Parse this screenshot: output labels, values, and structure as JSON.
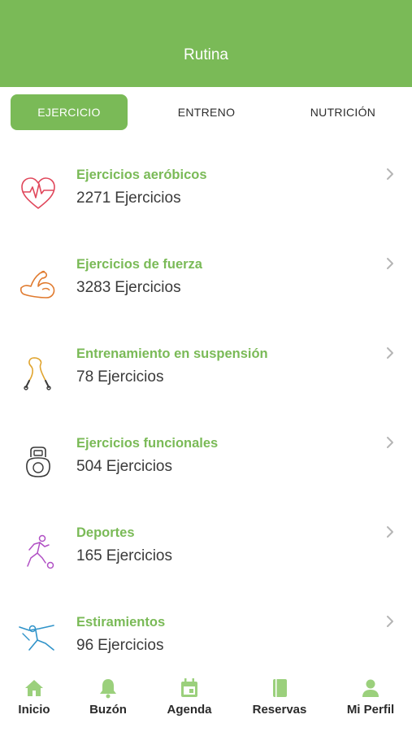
{
  "header": {
    "title": "Rutina"
  },
  "tabs": [
    {
      "label": "EJERCICIO",
      "active": true
    },
    {
      "label": "ENTRENO",
      "active": false
    },
    {
      "label": "NUTRICIÓN",
      "active": false
    }
  ],
  "categories": [
    {
      "title": "Ejercicios aeróbicos",
      "count": "2271",
      "unit": "Ejercicios",
      "icon": "heart-pulse-icon",
      "icon_color": "#e0475b"
    },
    {
      "title": "Ejercicios de fuerza",
      "count": "3283",
      "unit": "Ejercicios",
      "icon": "flexed-arm-icon",
      "icon_color": "#e07a2e"
    },
    {
      "title": "Entrenamiento en suspensión",
      "count": "78",
      "unit": "Ejercicios",
      "icon": "suspension-straps-icon",
      "icon_color": "#e0a42e"
    },
    {
      "title": "Ejercicios funcionales",
      "count": "504",
      "unit": "Ejercicios",
      "icon": "kettlebell-icon",
      "icon_color": "#3a3a3a"
    },
    {
      "title": "Deportes",
      "count": "165",
      "unit": "Ejercicios",
      "icon": "soccer-player-icon",
      "icon_color": "#b04fc4"
    },
    {
      "title": "Estiramientos",
      "count": "96",
      "unit": "Ejercicios",
      "icon": "stretching-icon",
      "icon_color": "#2f93c9"
    }
  ],
  "bottom_nav": [
    {
      "label": "Inicio",
      "icon": "home-icon"
    },
    {
      "label": "Buzón",
      "icon": "bell-icon"
    },
    {
      "label": "Agenda",
      "icon": "calendar-icon"
    },
    {
      "label": "Reservas",
      "icon": "book-icon"
    },
    {
      "label": "Mi Perfil",
      "icon": "user-icon"
    }
  ],
  "colors": {
    "accent": "#7aba57",
    "nav_icon": "#9bd07c",
    "text_dark": "#3a3a3a",
    "chevron": "#b5b5b5"
  }
}
